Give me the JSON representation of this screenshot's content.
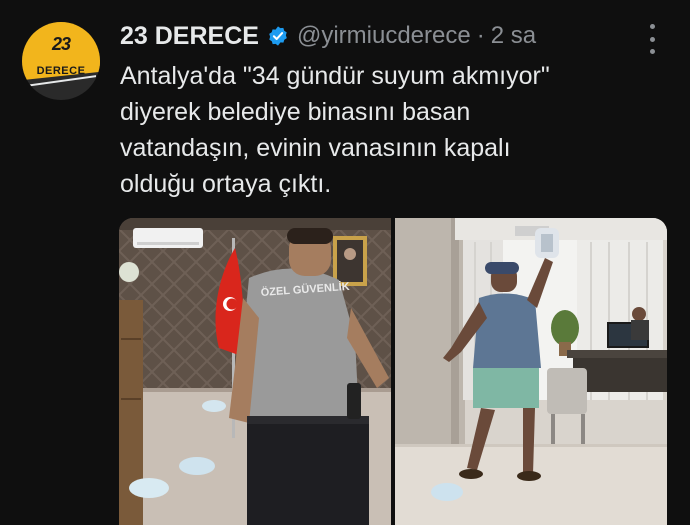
{
  "tweet": {
    "avatar": {
      "number": "23",
      "word": "DERECE"
    },
    "display_name": "23 DERECE",
    "handle": "@yirmiucderece",
    "separator": "·",
    "time": "2 sa",
    "text": "Antalya'da \"34 gündür suyum akmıyor\"\ndiyerek belediye binasını basan\nvatandaşın, evinin vanasının kapalı\nolduğu ortaya çıktı.",
    "media": [
      {
        "vest_text": "ÖZEL GÜVENLİK"
      },
      {
        "vest_text": ""
      }
    ]
  },
  "colors": {
    "background": "#0f0f0f",
    "text_primary": "#e7e9ea",
    "text_secondary": "#8b8f94",
    "verified": "#1d9bf0",
    "brand": "#f2b51c"
  },
  "icons": {
    "verified": "verified-badge-icon",
    "more": "more-dots-icon"
  }
}
